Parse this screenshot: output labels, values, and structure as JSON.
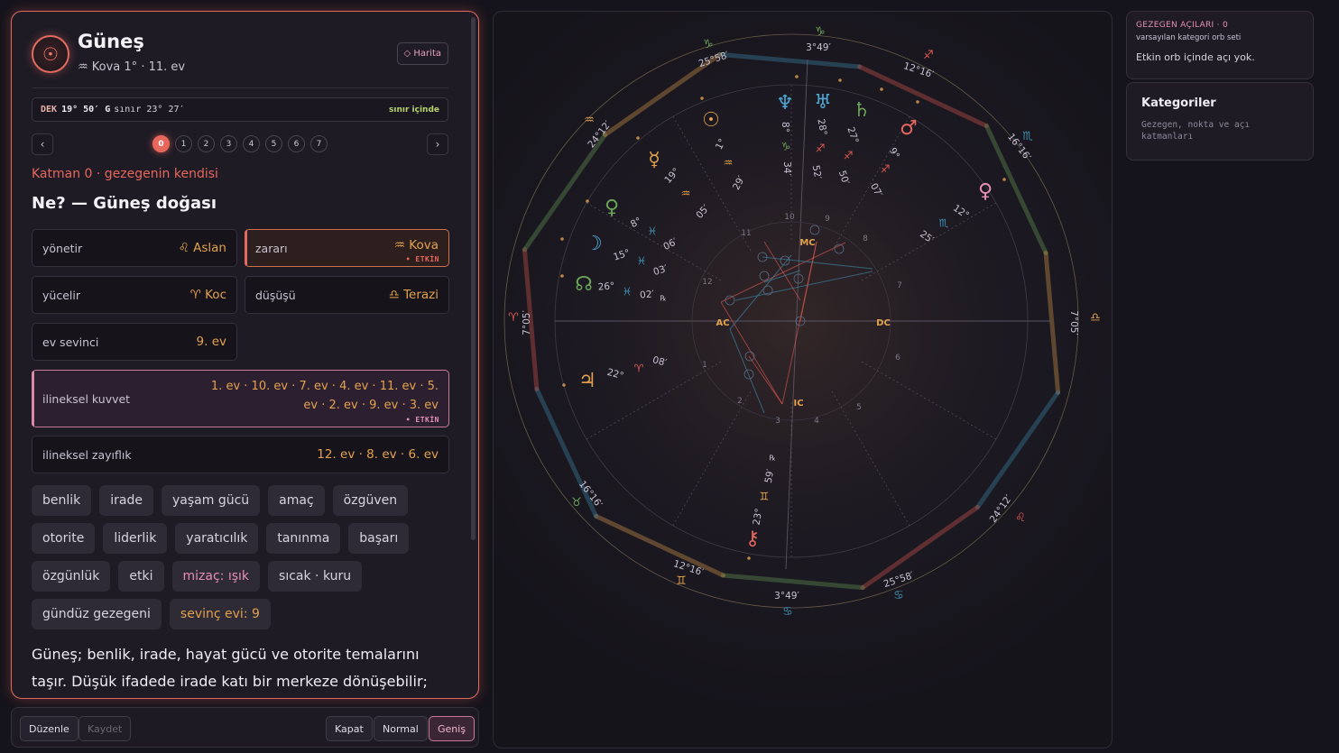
{
  "detail": {
    "planet_glyph": "☉",
    "planet_name": "Güneş",
    "position_text": "♒ Kova 1° · 11. ev",
    "map_button": "◇ Harita",
    "dek": {
      "label": "DEK",
      "degree": "19° 50′ G",
      "limit": "sınır 23° 27′",
      "status": "sınır içinde"
    },
    "pager": {
      "prev": "‹",
      "next": "›",
      "pages": [
        "0",
        "1",
        "2",
        "3",
        "4",
        "5",
        "6",
        "7"
      ],
      "active": "0"
    },
    "layer_title": "Katman 0 · gezegenin kendisi",
    "section_title": "Ne? — Güneş doğası",
    "dignities": {
      "rules": {
        "key": "yönetir",
        "value": "♌ Aslan"
      },
      "detriment": {
        "key": "zararı",
        "value": "♒ Kova",
        "badge": "• ETKİN"
      },
      "exaltation": {
        "key": "yücelir",
        "value": "♈ Koc"
      },
      "fall": {
        "key": "düşüşü",
        "value": "♎ Terazi"
      },
      "joy": {
        "key": "ev sevinci",
        "value": "9. ev"
      },
      "accidental_strength": {
        "key": "ilineksel kuvvet",
        "value": "1. ev · 10. ev · 7. ev · 4. ev · 11. ev · 5. ev · 2. ev · 9. ev · 3. ev",
        "badge": "• ETKİN"
      },
      "accidental_weakness": {
        "key": "ilineksel zayıflık",
        "value": "12. ev · 8. ev · 6. ev"
      }
    },
    "tags": [
      "benlik",
      "irade",
      "yaşam gücü",
      "amaç",
      "özgüven",
      "otorite",
      "liderlik",
      "yaratıcılık",
      "tanınma",
      "başarı",
      "özgünlük",
      "etki",
      "mizaç: ışık",
      "sıcak · kuru",
      "gündüz gezegeni",
      "sevinç evi: 9"
    ],
    "tag_styles": {
      "mizaç: ışık": "pink",
      "sevinç evi: 9": "gold"
    },
    "description": "Güneş; benlik, irade, hayat gücü ve otorite temalarını taşır. Düşük ifadede irade katı bir merkeze dönüşebilir;"
  },
  "bottom_bar": {
    "edit": "Düzenle",
    "save": "Kaydet",
    "close": "Kapat",
    "normal": "Normal",
    "wide": "Geniş"
  },
  "aspects": {
    "title": "GEZEGEN AÇILARI · 0",
    "subtitle": "varsayılan kategori orb seti",
    "empty": "Etkin orb içinde açı yok."
  },
  "categories": {
    "title": "Kategoriler",
    "subtitle": "Gezegen, nokta ve açı katmanları"
  },
  "chart": {
    "colors": {
      "fire": "#e05a52",
      "earth": "#6aa458",
      "air": "#e3a24e",
      "water": "#3d8fb0",
      "sun": "#e3a24e",
      "mars": "#e8675c"
    },
    "angles": {
      "mc": "MC",
      "ac": "AC",
      "dc": "DC",
      "ic": "IC"
    },
    "house_numbers": [
      "1",
      "2",
      "3",
      "4",
      "5",
      "6",
      "7",
      "8",
      "9",
      "10",
      "11",
      "12"
    ],
    "cusps": [
      {
        "deg": "3°49′",
        "sign": "♑"
      },
      {
        "deg": "12°16′",
        "sign": "♐"
      },
      {
        "deg": "16°16′",
        "sign": "♏"
      },
      {
        "deg": "7°05′",
        "sign": "♎"
      },
      {
        "deg": "24°12′",
        "sign": "♌"
      },
      {
        "deg": "25°58′",
        "sign": "♋"
      },
      {
        "deg": "3°49′",
        "sign": "♋"
      },
      {
        "deg": "12°16′",
        "sign": "♊"
      },
      {
        "deg": "16°16′",
        "sign": "♉"
      },
      {
        "deg": "7°05′",
        "sign": "♈"
      },
      {
        "deg": "24°12′",
        "sign": "♒"
      },
      {
        "deg": "25°58′",
        "sign": "♑"
      }
    ],
    "planets": [
      {
        "name": "Neptün",
        "glyph": "♆",
        "deg": "8°",
        "sign": "♑",
        "min": "34′"
      },
      {
        "name": "Uranüs",
        "glyph": "♅",
        "deg": "28°",
        "sign": "♐",
        "min": "52′"
      },
      {
        "name": "Satürn",
        "glyph": "♄",
        "deg": "27°",
        "sign": "♐",
        "min": "50′"
      },
      {
        "name": "Mars",
        "glyph": "♂",
        "deg": "9°",
        "sign": "♐",
        "min": "07′"
      },
      {
        "name": "Venüs",
        "glyph": "♀",
        "deg": "12°",
        "sign": "♏",
        "min": "25′"
      },
      {
        "name": "Güneş",
        "glyph": "☉",
        "deg": "1°",
        "sign": "♒",
        "min": "29′"
      },
      {
        "name": "Merkür",
        "glyph": "☿",
        "deg": "19°",
        "sign": "♒",
        "min": "05′"
      },
      {
        "name": "Venüs",
        "glyph": "♀",
        "deg": "8°",
        "sign": "♓",
        "min": "06′"
      },
      {
        "name": "Ay",
        "glyph": "☽",
        "deg": "15°",
        "sign": "♓",
        "min": "03′"
      },
      {
        "name": "Düğüm",
        "glyph": "☊",
        "deg": "26°",
        "sign": "♓",
        "min": "02′",
        "retro": "℞"
      },
      {
        "name": "Jüpiter",
        "glyph": "♃",
        "deg": "22°",
        "sign": "♈",
        "min": "08′"
      },
      {
        "name": "Kiron",
        "glyph": "⚷",
        "deg": "23°",
        "sign": "♊",
        "min": "59′",
        "retro": "℞"
      }
    ]
  }
}
